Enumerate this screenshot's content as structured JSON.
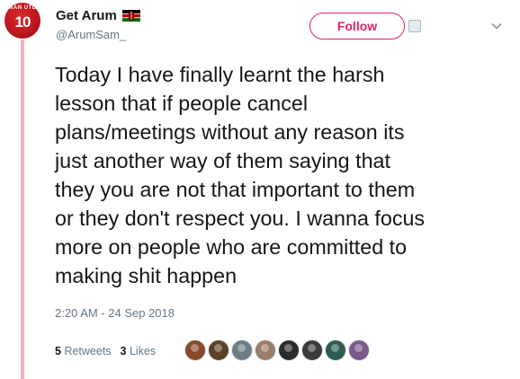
{
  "tweet": {
    "author": {
      "name": "Get Arum",
      "handle": "@ArumSam_",
      "avatar_number": "10",
      "avatar_top_text": "MAN UTD"
    },
    "follow_label": "Follow",
    "text_lines": [
      "Today I have finally learnt the harsh",
      "lesson that if people cancel",
      "plans/meetings without any reason its",
      "just another way of them saying that",
      "they you are not that important to them",
      "or they don't respect you. I wanna focus",
      "more on people who are committed to",
      "making shit happen"
    ],
    "timestamp": "2:20 AM - 24 Sep 2018",
    "retweets": {
      "count": "5",
      "label": "Retweets"
    },
    "likes": {
      "count": "3",
      "label": "Likes"
    }
  },
  "liker_avatars": [
    "#8a4b2a",
    "#5c4326",
    "#6f7e86",
    "#9a7e6a",
    "#2c2c2c",
    "#3a3a3a",
    "#2f5d56",
    "#7a5a8a"
  ],
  "colors": {
    "accent": "#e0245e",
    "rail": "#f2b1b8",
    "secondary_text": "#657786",
    "primary_text": "#14171a"
  },
  "icons": {
    "flag": "kenya-flag-icon",
    "menu": "chevron-down-icon"
  }
}
